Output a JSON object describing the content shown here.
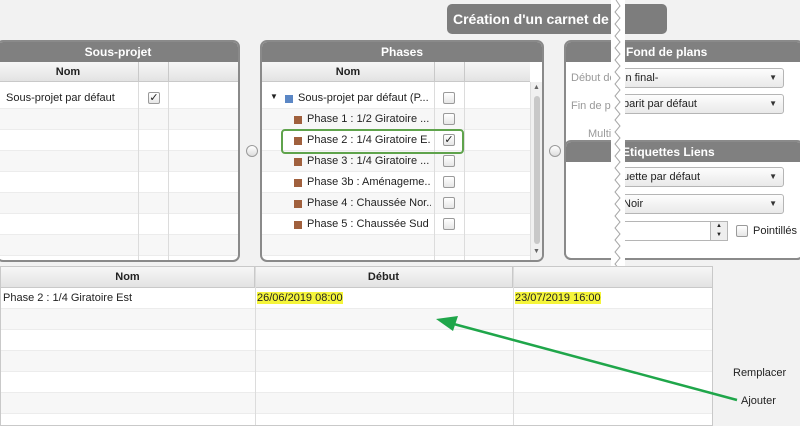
{
  "title": "Création d'un carnet de p",
  "sousprojet": {
    "header": "Sous-projet",
    "col_nom": "Nom",
    "rows": [
      {
        "label": "Sous-projet par défaut",
        "checked": true
      }
    ]
  },
  "phases": {
    "header": "Phases",
    "col_nom": "Nom",
    "root": {
      "label": "Sous-projet par défaut (P...",
      "color": "#5b87c5",
      "checked": false
    },
    "items": [
      {
        "label": "Phase 1 : 1/2 Giratoire ...",
        "checked": false
      },
      {
        "label": "Phase 2 : 1/4 Giratoire E...",
        "checked": true,
        "highlighted": true
      },
      {
        "label": "Phase 3 : 1/4 Giratoire ...",
        "checked": false
      },
      {
        "label": "Phase 3b : Aménageme...",
        "checked": false
      },
      {
        "label": "Phase 4 : Chaussée Nor...",
        "checked": false
      },
      {
        "label": "Phase 5 : Chaussée Sud ...",
        "checked": false
      }
    ],
    "item_color": "#a0603d",
    "check_mark": "✓"
  },
  "fond": {
    "header": "Fond de plans",
    "debut_label": "Début de",
    "debut_value": "in final-",
    "fin_label": "Fin de ph",
    "fin_value": "barit par défaut",
    "multi_label": "Multip"
  },
  "etiquettes": {
    "header": "Etiquettes Liens",
    "select1": "uette par défaut",
    "select2": "Noir",
    "pointilles": "Pointillés"
  },
  "grid": {
    "col_nom": "Nom",
    "col_debut": "Début",
    "rows": [
      {
        "nom": "Phase 2 : 1/4 Giratoire Est",
        "debut": "26/06/2019 08:00",
        "fin": "23/07/2019 16:00"
      }
    ]
  },
  "actions": {
    "remplacer": "Remplacer",
    "ajouter": "Ajouter"
  },
  "colors": {
    "panel_header": "#808080",
    "highlight_border": "#5fa34c",
    "arrow": "#1fa64a",
    "date_highlight": "#f5f53a"
  }
}
